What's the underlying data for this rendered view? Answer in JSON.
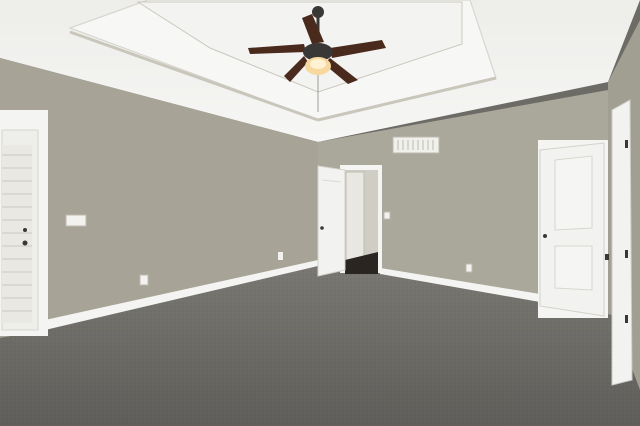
{
  "scene": {
    "colors": {
      "ceiling": "#f1f1ef",
      "tray": "#f6f6f4",
      "wall_left": "#a7a497",
      "wall_back": "#a9a69a",
      "wall_right": "#a09d91",
      "trim": "#f4f4f2",
      "carpet": "#6d6b66",
      "door": "#f2f2f0",
      "closet_dark": "#2a2521",
      "fan_wood": "#4a2a1c",
      "fan_metal": "#3a3836",
      "light": "#f7d9a0"
    },
    "icons": [
      "ceiling-fan-icon",
      "air-vent-icon",
      "light-switch-icon",
      "outlet-icon",
      "door-handle-icon"
    ]
  }
}
